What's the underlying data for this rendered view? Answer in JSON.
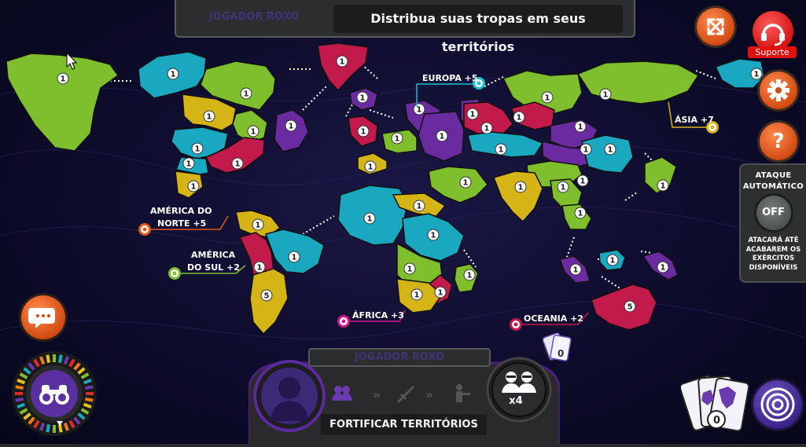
{
  "header": {
    "player_label": "JOGADOR ROXO",
    "instruction": "Distribua suas tropas em seus territórios"
  },
  "top_right": {
    "fullscreen_icon": "expand-icon",
    "support_label": "Suporte",
    "settings_icon": "gear-icon",
    "help_icon": "question-icon"
  },
  "auto_attack": {
    "title": "ATAQUE AUTOMÁTICO",
    "toggle": "OFF",
    "description": "ATACARÁ ATÉ ACABAREM OS EXÉRCITOS DISPONÍVEIS"
  },
  "continents": {
    "europe": "EUROPA +5",
    "asia": "ÁSIA +7",
    "north_america": "AMÉRICA DO NORTE +5",
    "south_america": "AMÉRICA DO SUL +2",
    "africa": "ÁFRICA +3",
    "oceania": "OCEANIA +2"
  },
  "territories": [
    {
      "c": "#7fbf2e",
      "a": "1"
    },
    {
      "c": "#1aa7c0",
      "a": "1"
    },
    {
      "c": "#7fbf2e",
      "a": "1"
    },
    {
      "c": "#c21a4a",
      "a": "1"
    },
    {
      "c": "#d4b417",
      "a": "1"
    },
    {
      "c": "#7fbf2e",
      "a": "1"
    },
    {
      "c": "#6a2aa0",
      "a": "1"
    },
    {
      "c": "#1aa7c0",
      "a": "1"
    },
    {
      "c": "#c21a4a",
      "a": "1"
    },
    {
      "c": "#d4b417",
      "a": "1"
    },
    {
      "c": "#1aa7c0",
      "a": "1"
    },
    {
      "c": "#d4b417",
      "a": "1"
    },
    {
      "c": "#c21a4a",
      "a": "1"
    },
    {
      "c": "#d4b417",
      "a": "5"
    },
    {
      "c": "#1aa7c0",
      "a": "1"
    },
    {
      "c": "#6a2aa0",
      "a": "1"
    },
    {
      "c": "#c21a4a",
      "a": "1"
    },
    {
      "c": "#6a2aa0",
      "a": "1"
    },
    {
      "c": "#7fbf2e",
      "a": "1"
    },
    {
      "c": "#d4b417",
      "a": "1"
    },
    {
      "c": "#6a2aa0",
      "a": "1"
    },
    {
      "c": "#6a2aa0",
      "a": "1"
    },
    {
      "c": "#1aa7c0",
      "a": "1"
    },
    {
      "c": "#d4b417",
      "a": "1"
    },
    {
      "c": "#1aa7c0",
      "a": "1"
    },
    {
      "c": "#7fbf2e",
      "a": "1"
    },
    {
      "c": "#c21a4a",
      "a": "1"
    },
    {
      "c": "#d4b417",
      "a": "1"
    },
    {
      "c": "#7fbf2e",
      "a": "1"
    },
    {
      "c": "#c21a4a",
      "a": "1"
    },
    {
      "c": "#7fbf2e",
      "a": "1"
    },
    {
      "c": "#c21a4a",
      "a": "1"
    },
    {
      "c": "#6a2aa0",
      "a": "1"
    },
    {
      "c": "#7fbf2e",
      "a": "1"
    },
    {
      "c": "#1aa7c0",
      "a": "1"
    },
    {
      "c": "#6a2aa0",
      "a": "1"
    },
    {
      "c": "#7fbf2e",
      "a": "1"
    },
    {
      "c": "#7fbf2e",
      "a": "1"
    },
    {
      "c": "#1aa7c0",
      "a": "1"
    },
    {
      "c": "#d4b417",
      "a": "1"
    },
    {
      "c": "#7fbf2e",
      "a": "1"
    },
    {
      "c": "#7fbf2e",
      "a": "1"
    },
    {
      "c": "#7fbf2e",
      "a": "1"
    },
    {
      "c": "#1aa7c0",
      "a": "1"
    },
    {
      "c": "#6a2aa0",
      "a": "1"
    },
    {
      "c": "#6a2aa0",
      "a": "1"
    },
    {
      "c": "#c21a4a",
      "a": "5"
    },
    {
      "c": "#1aa7c0",
      "a": "1"
    }
  ],
  "hud": {
    "player_label": "JOGADOR ROXO",
    "phase_button": "FORTIFICAR TERRITÓRIOS",
    "reinforcements": "x4",
    "cards_small_count": "0",
    "cards_big_count": "0"
  },
  "colors": {
    "green": "#7fbf2e",
    "cyan": "#1aa7c0",
    "red": "#c21a4a",
    "yellow": "#d4b417",
    "purple": "#6a2aa0",
    "orange": "#e05a1a"
  }
}
